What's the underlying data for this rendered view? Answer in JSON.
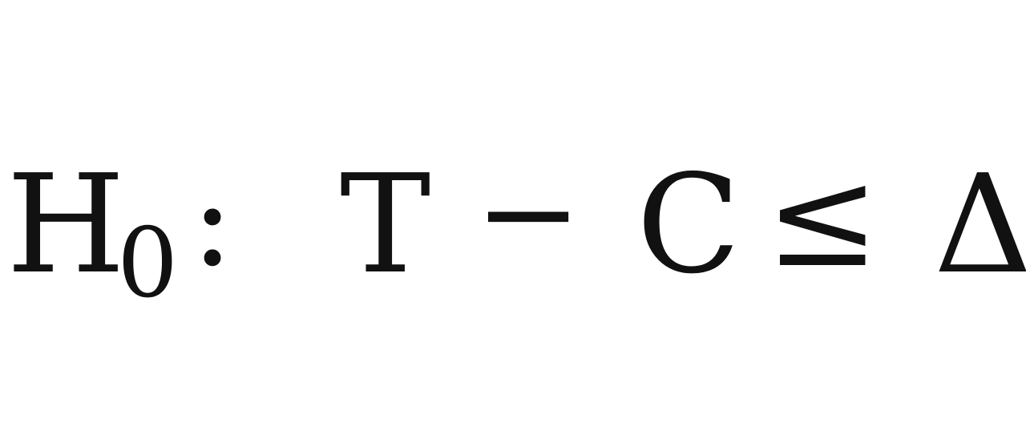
{
  "formula": {
    "h": "H",
    "subscript": "0",
    "colon": ":",
    "t": "T",
    "minus": "−",
    "c": "C",
    "leq": "≤",
    "delta": "Δ"
  }
}
